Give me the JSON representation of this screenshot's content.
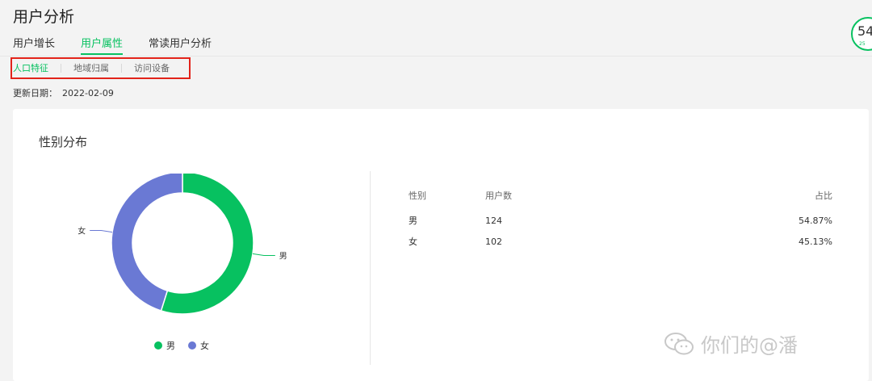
{
  "page": {
    "title": "用户分析"
  },
  "tabs": [
    {
      "label": "用户增长"
    },
    {
      "label": "用户属性"
    },
    {
      "label": "常读用户分析"
    }
  ],
  "subtabs": [
    {
      "label": "人口特征"
    },
    {
      "label": "地域归属"
    },
    {
      "label": "访问设备"
    }
  ],
  "update": {
    "label": "更新日期：",
    "date": "2022-02-09"
  },
  "badge": {
    "number": "54",
    "sub": "25"
  },
  "gender": {
    "title": "性别分布",
    "table": {
      "headers": [
        "性别",
        "用户数",
        "占比"
      ],
      "rows": [
        [
          "男",
          "124",
          "54.87%"
        ],
        [
          "女",
          "102",
          "45.13%"
        ]
      ]
    }
  },
  "chart_data": {
    "type": "pie",
    "title": "性别分布",
    "categories": [
      "男",
      "女"
    ],
    "values": [
      124,
      102
    ],
    "colors": [
      "#07c160",
      "#6a79d4"
    ],
    "legend": "bottom",
    "donut": true
  },
  "watermark": {
    "text": "你们的@潘"
  }
}
